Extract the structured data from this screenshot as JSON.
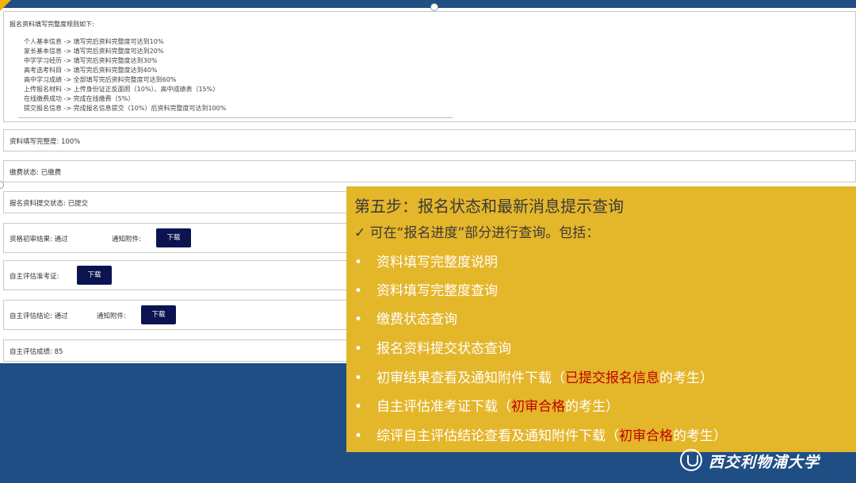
{
  "rules": {
    "title": "报名资料填写完整度规则如下:",
    "lines": [
      "个人基本信息 -> 填写完后资料完整度可达到10%",
      "家长基本信息 -> 填写完后资料完整度可达到20%",
      "中学学习经历 -> 填写完后资料完整度达到30%",
      "高考选考科目 -> 填写完后资料完整度达到40%",
      "高中学习成绩 -> 全部填写完后资料完整度可达到60%",
      "上传报名材料 -> 上传身份证正反面照（10%）、高中成绩表（15%）",
      "在线缴费成功 -> 完成在线缴费（5%）",
      "提交报名信息 -> 完成报名信息提交（10%）后资料完整度可达到100%"
    ]
  },
  "fields": {
    "completeness": "资料填写完整度: 100%",
    "payment": "缴费状态: 已缴费",
    "submission": "报名资料提交状态: 已提交",
    "initial_review": "资格初审结果: 通过",
    "notice_attachment": "通知附件:",
    "admission_ticket": "自主评估准考证:",
    "assessment_result": "自主评估结论: 通过",
    "notice_attachment2": "通知附件:",
    "assessment_score": "自主评估成绩: 85",
    "download": "下载"
  },
  "overlay": {
    "title": "第五步：报名状态和最新消息提示查询",
    "subtitle": "✓ 可在“报名进度”部分进行查询。包括：",
    "bullet": "•",
    "items": [
      {
        "text": "资料填写完整度说明"
      },
      {
        "text": "资料填写完整度查询"
      },
      {
        "text": "缴费状态查询"
      },
      {
        "text": "报名资料提交状态查询"
      },
      {
        "text": "初审结果查看及通知附件下载（",
        "red": "已提交报名信息",
        "tail": "的考生）"
      },
      {
        "text": "自主评估准考证下载（",
        "red": "初审合格",
        "tail": "的考生）"
      },
      {
        "text": "综评自主评估结论查看及通知附件下载（",
        "red": "初审合格",
        "tail": "的考生）"
      }
    ],
    "colors": {
      "background": "#e4b62a",
      "highlight": "#c00000",
      "text": "#ffffff"
    }
  },
  "logo": {
    "text": "西交利物浦大学"
  }
}
